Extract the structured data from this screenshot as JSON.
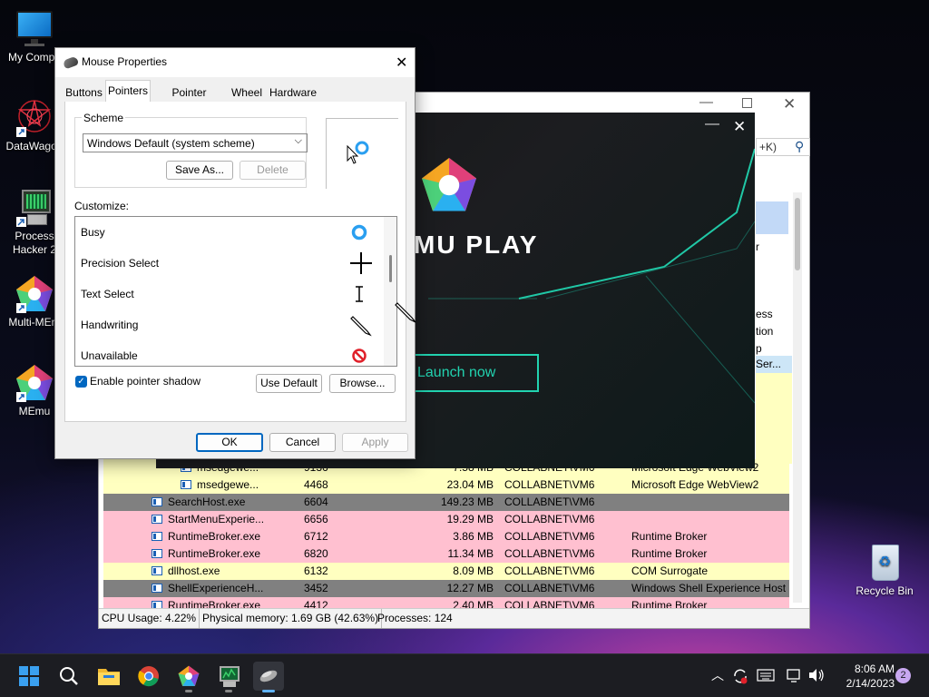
{
  "desktop": {
    "icons": [
      {
        "label": "My Compu",
        "icon": "monitor-icon"
      },
      {
        "label": "DataWagon",
        "icon": "datawagon-icon"
      },
      {
        "label": "Process Hacker 2",
        "line1": "Process",
        "line2": "Hacker 2",
        "icon": "process-hacker-icon"
      },
      {
        "label": "Multi-MEm",
        "icon": "memu-multi-icon"
      },
      {
        "label": "MEmu",
        "icon": "memu-icon"
      },
      {
        "label": "Recycle Bin",
        "icon": "recycle-bin-icon"
      }
    ]
  },
  "process_hacker": {
    "search_hint": "+K)",
    "bg_fragments": [
      "r",
      "ess",
      "tion",
      "p",
      "Ser..."
    ],
    "rows": [
      {
        "name": "msedgewe...",
        "pid": "9136",
        "mem": "7.58 MB",
        "user": "COLLABNET\\VM6",
        "desc": "Microsoft Edge WebView2",
        "color": "#ffffc0",
        "indent": 2
      },
      {
        "name": "msedgewe...",
        "pid": "4468",
        "mem": "23.04 MB",
        "user": "COLLABNET\\VM6",
        "desc": "Microsoft Edge WebView2",
        "color": "#ffffc0",
        "indent": 2
      },
      {
        "name": "SearchHost.exe",
        "pid": "6604",
        "mem": "149.23 MB",
        "user": "COLLABNET\\VM6",
        "desc": "",
        "color": "#808080",
        "indent": 1
      },
      {
        "name": "StartMenuExperie...",
        "pid": "6656",
        "mem": "19.29 MB",
        "user": "COLLABNET\\VM6",
        "desc": "",
        "color": "#ffc0d0",
        "indent": 1
      },
      {
        "name": "RuntimeBroker.exe",
        "pid": "6712",
        "mem": "3.86 MB",
        "user": "COLLABNET\\VM6",
        "desc": "Runtime Broker",
        "color": "#ffc0d0",
        "indent": 1
      },
      {
        "name": "RuntimeBroker.exe",
        "pid": "6820",
        "mem": "11.34 MB",
        "user": "COLLABNET\\VM6",
        "desc": "Runtime Broker",
        "color": "#ffc0d0",
        "indent": 1
      },
      {
        "name": "dllhost.exe",
        "pid": "6132",
        "mem": "8.09 MB",
        "user": "COLLABNET\\VM6",
        "desc": "COM Surrogate",
        "color": "#ffffc0",
        "indent": 1
      },
      {
        "name": "ShellExperienceH...",
        "pid": "3452",
        "mem": "12.27 MB",
        "user": "COLLABNET\\VM6",
        "desc": "Windows Shell Experience Host",
        "color": "#808080",
        "indent": 1
      },
      {
        "name": "RuntimeBroker.exe",
        "pid": "4412",
        "mem": "2.40 MB",
        "user": "COLLABNET\\VM6",
        "desc": "Runtime Broker",
        "color": "#ffc0d0",
        "indent": 1
      }
    ],
    "status": {
      "cpu": "CPU Usage: 4.22%",
      "memory": "Physical memory: 1.69 GB (42.63%)",
      "processes": "Processes: 124"
    }
  },
  "memu": {
    "brand": "MU PLAY",
    "launch_label": "Launch now",
    "accent": "#22d3b0"
  },
  "mouse_properties": {
    "title": "Mouse Properties",
    "tabs": [
      "Buttons",
      "Pointers",
      "Pointer Options",
      "Wheel",
      "Hardware"
    ],
    "active_tab": "Pointers",
    "scheme_label": "Scheme",
    "scheme_value": "Windows Default (system scheme)",
    "save_as_label": "Save As...",
    "delete_label": "Delete",
    "customize_label": "Customize:",
    "cursors": [
      {
        "name": "Busy",
        "icon": "busy-cursor-icon"
      },
      {
        "name": "Precision Select",
        "icon": "crosshair-cursor-icon"
      },
      {
        "name": "Text Select",
        "icon": "text-cursor-icon"
      },
      {
        "name": "Handwriting",
        "icon": "pen-cursor-icon"
      },
      {
        "name": "Unavailable",
        "icon": "unavailable-cursor-icon"
      }
    ],
    "shadow_label": "Enable pointer shadow",
    "shadow_checked": true,
    "use_default_label": "Use Default",
    "browse_label": "Browse...",
    "ok_label": "OK",
    "cancel_label": "Cancel",
    "apply_label": "Apply"
  },
  "taskbar": {
    "time": "8:06 AM",
    "date": "2/14/2023",
    "notification_count": "2"
  }
}
